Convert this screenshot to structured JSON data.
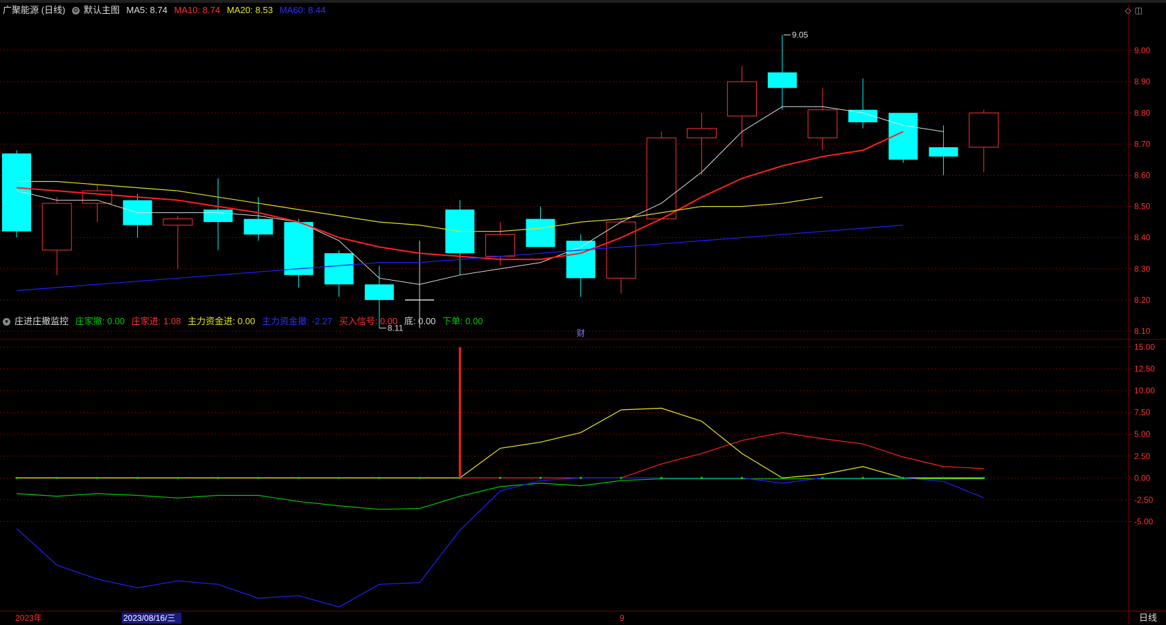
{
  "main_header": {
    "stock": "广聚能源 (日线)",
    "template": "默认主图",
    "ma5": "MA5: 8.74",
    "ma10": "MA10: 8.74",
    "ma20": "MA20: 8.53",
    "ma60": "MA60: 8.44"
  },
  "sub_header": {
    "name": "庄进庄撤监控",
    "v1": "庄家撤: 0.00",
    "v2": "庄家进: 1.08",
    "v3": "主力资金进: 0.00",
    "v4": "主力资金撤: -2.27",
    "v5": "买入信号: 0.00",
    "v6": "底: 0.00",
    "v7": "下单: 0.00"
  },
  "annotations": {
    "high": "9.05",
    "low": "8.11",
    "finance": "财"
  },
  "bottom": {
    "year": "2023年",
    "date": "2023/08/16/三",
    "month": "9",
    "period": "日线"
  },
  "colors": {
    "up": "#ff3232",
    "down": "#00ffff",
    "ma5": "#dddddd",
    "ma10": "#ff2020",
    "ma20": "#e0e020",
    "ma60": "#2020ff",
    "grid": "#7a0000",
    "green": "#00cc00"
  },
  "chart_data": [
    {
      "type": "candlestick",
      "y_ticks": [
        "8.10",
        "8.20",
        "8.30",
        "8.40",
        "8.50",
        "8.60",
        "8.70",
        "8.80",
        "8.90",
        "9.00"
      ],
      "ylim": [
        8.08,
        9.1
      ],
      "candles": [
        {
          "o": 8.67,
          "c": 8.42,
          "h": 8.68,
          "l": 8.4
        },
        {
          "o": 8.36,
          "c": 8.51,
          "h": 8.53,
          "l": 8.28
        },
        {
          "o": 8.51,
          "c": 8.55,
          "h": 8.57,
          "l": 8.45
        },
        {
          "o": 8.52,
          "c": 8.44,
          "h": 8.54,
          "l": 8.4
        },
        {
          "o": 8.44,
          "c": 8.46,
          "h": 8.47,
          "l": 8.3
        },
        {
          "o": 8.49,
          "c": 8.45,
          "h": 8.59,
          "l": 8.36
        },
        {
          "o": 8.46,
          "c": 8.41,
          "h": 8.53,
          "l": 8.39
        },
        {
          "o": 8.45,
          "c": 8.28,
          "h": 8.46,
          "l": 8.24
        },
        {
          "o": 8.35,
          "c": 8.25,
          "h": 8.36,
          "l": 8.21
        },
        {
          "o": 8.25,
          "c": 8.2,
          "h": 8.31,
          "l": 8.11
        },
        {
          "o": 8.2,
          "c": 8.2,
          "h": 8.39,
          "l": 8.11
        },
        {
          "o": 8.49,
          "c": 8.35,
          "h": 8.52,
          "l": 8.28
        },
        {
          "o": 8.34,
          "c": 8.41,
          "h": 8.45,
          "l": 8.31
        },
        {
          "o": 8.46,
          "c": 8.37,
          "h": 8.5,
          "l": 8.37
        },
        {
          "o": 8.39,
          "c": 8.27,
          "h": 8.41,
          "l": 8.21
        },
        {
          "o": 8.27,
          "c": 8.45,
          "h": 8.46,
          "l": 8.22
        },
        {
          "o": 8.46,
          "c": 8.72,
          "h": 8.74,
          "l": 8.46
        },
        {
          "o": 8.72,
          "c": 8.75,
          "h": 8.8,
          "l": 8.6
        },
        {
          "o": 8.79,
          "c": 8.9,
          "h": 8.95,
          "l": 8.69
        },
        {
          "o": 8.93,
          "c": 8.88,
          "h": 9.05,
          "l": 8.81
        },
        {
          "o": 8.72,
          "c": 8.81,
          "h": 8.88,
          "l": 8.68
        },
        {
          "o": 8.81,
          "c": 8.77,
          "h": 8.91,
          "l": 8.75
        },
        {
          "o": 8.8,
          "c": 8.65,
          "h": 8.8,
          "l": 8.64
        },
        {
          "o": 8.69,
          "c": 8.66,
          "h": 8.76,
          "l": 8.6
        },
        {
          "o": 8.69,
          "c": 8.8,
          "h": 8.81,
          "l": 8.61
        }
      ],
      "series": [
        {
          "name": "MA5",
          "values": [
            8.55,
            8.52,
            8.52,
            8.48,
            8.48,
            8.48,
            8.47,
            8.45,
            8.39,
            8.27,
            8.25,
            8.28,
            8.3,
            8.32,
            8.37,
            8.45,
            8.51,
            8.61,
            8.74,
            8.82,
            8.82,
            8.8,
            8.76,
            8.74
          ]
        },
        {
          "name": "MA10",
          "values": [
            8.56,
            8.55,
            8.54,
            8.53,
            8.52,
            8.5,
            8.48,
            8.45,
            8.4,
            8.37,
            8.35,
            8.34,
            8.33,
            8.33,
            8.35,
            8.4,
            8.46,
            8.53,
            8.59,
            8.63,
            8.66,
            8.68,
            8.74
          ]
        },
        {
          "name": "MA20",
          "values": [
            8.58,
            8.58,
            8.57,
            8.56,
            8.55,
            8.53,
            8.51,
            8.49,
            8.47,
            8.45,
            8.44,
            8.42,
            8.42,
            8.43,
            8.45,
            8.46,
            8.48,
            8.5,
            8.5,
            8.51,
            8.53
          ]
        },
        {
          "name": "MA60",
          "values": [
            8.23,
            8.24,
            8.25,
            8.26,
            8.27,
            8.28,
            8.29,
            8.3,
            8.31,
            8.32,
            8.32,
            8.33,
            8.34,
            8.35,
            8.36,
            8.37,
            8.38,
            8.39,
            8.4,
            8.41,
            8.42,
            8.43,
            8.44
          ]
        }
      ]
    },
    {
      "type": "line",
      "y_ticks": [
        "15.00",
        "12.50",
        "10.00",
        "7.50",
        "5.00",
        "2.50",
        "0.00",
        "-2.50",
        "-5.00"
      ],
      "ylim": [
        -15.2,
        15.8
      ],
      "series": [
        {
          "name": "庄家撤",
          "values": [
            -1.8,
            -2.1,
            -1.8,
            -2.0,
            -2.3,
            -2.0,
            -2.0,
            -2.7,
            -3.2,
            -3.6,
            -3.5,
            -2.1,
            -1.0,
            -0.6,
            -0.9,
            -0.3,
            -0.1,
            -0.1,
            -0.1,
            -0.1,
            -0.1,
            -0.1,
            -0.1,
            -0.1,
            -0.1
          ]
        },
        {
          "name": "庄家进",
          "values": [
            0,
            0,
            0,
            0,
            0,
            0,
            0,
            0,
            0,
            0,
            0,
            0,
            0,
            0,
            0,
            0,
            1.6,
            2.8,
            4.3,
            5.2,
            4.5,
            3.9,
            2.4,
            1.3,
            1.08
          ]
        },
        {
          "name": "主力资金进",
          "values": [
            0,
            0,
            0,
            0,
            0,
            0,
            0,
            0,
            0,
            0,
            0,
            0,
            3.4,
            4.1,
            5.2,
            7.8,
            8.0,
            6.5,
            2.8,
            0.0,
            0.4,
            1.3,
            0.0,
            0.0,
            0.0
          ]
        },
        {
          "name": "主力资金撤",
          "values": [
            -5.8,
            -10.0,
            -11.6,
            -12.6,
            -11.8,
            -12.2,
            -13.8,
            -13.5,
            -14.8,
            -12.2,
            -12.0,
            -6.0,
            -1.5,
            -0.3,
            0.0,
            0.0,
            0.0,
            0.0,
            0.0,
            -0.6,
            0.0,
            0.0,
            0.0,
            -0.4,
            -2.27
          ]
        }
      ],
      "spike": {
        "index": 11,
        "value": 15.0
      }
    }
  ]
}
